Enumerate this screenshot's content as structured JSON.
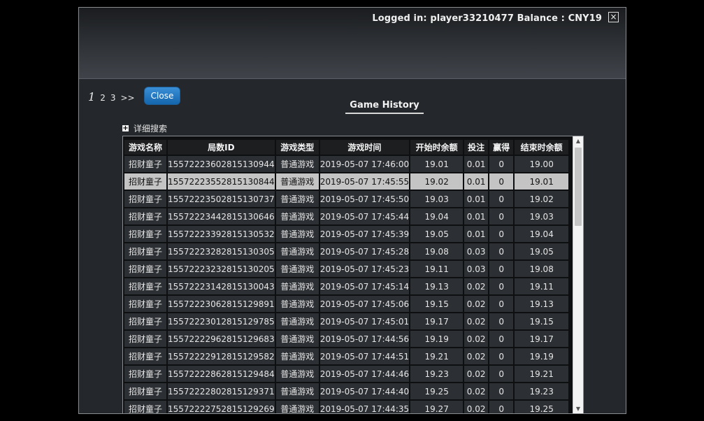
{
  "header": {
    "login_label": "Logged in: ",
    "username": "player33210477",
    "balance_label": "Balance : ",
    "balance": "CNY19",
    "close_icon": "×"
  },
  "pager": {
    "pages": [
      "1",
      "2",
      "3"
    ],
    "next": ">>",
    "current": "1"
  },
  "close_button_label": "Close",
  "title": "Game History",
  "search": {
    "icon": "+",
    "label": "详细搜索"
  },
  "table": {
    "columns": [
      "游戏名称",
      "局数ID",
      "游戏类型",
      "游戏时间",
      "开始时余额",
      "投注",
      "赢得",
      "结束时余额"
    ],
    "rows": [
      [
        "招财童子",
        "15572223602815130944",
        "普通游戏",
        "2019-05-07 17:46:00",
        "19.01",
        "0.01",
        "0",
        "19.00"
      ],
      [
        "招财童子",
        "15572223552815130844",
        "普通游戏",
        "2019-05-07 17:45:55",
        "19.02",
        "0.01",
        "0",
        "19.01"
      ],
      [
        "招财童子",
        "15572223502815130737",
        "普通游戏",
        "2019-05-07 17:45:50",
        "19.03",
        "0.01",
        "0",
        "19.02"
      ],
      [
        "招财童子",
        "15572223442815130646",
        "普通游戏",
        "2019-05-07 17:45:44",
        "19.04",
        "0.01",
        "0",
        "19.03"
      ],
      [
        "招财童子",
        "15572223392815130532",
        "普通游戏",
        "2019-05-07 17:45:39",
        "19.05",
        "0.01",
        "0",
        "19.04"
      ],
      [
        "招财童子",
        "15572223282815130305",
        "普通游戏",
        "2019-05-07 17:45:28",
        "19.08",
        "0.03",
        "0",
        "19.05"
      ],
      [
        "招财童子",
        "15572223232815130205",
        "普通游戏",
        "2019-05-07 17:45:23",
        "19.11",
        "0.03",
        "0",
        "19.08"
      ],
      [
        "招财童子",
        "15572223142815130043",
        "普通游戏",
        "2019-05-07 17:45:14",
        "19.13",
        "0.02",
        "0",
        "19.11"
      ],
      [
        "招财童子",
        "15572223062815129891",
        "普通游戏",
        "2019-05-07 17:45:06",
        "19.15",
        "0.02",
        "0",
        "19.13"
      ],
      [
        "招财童子",
        "15572223012815129785",
        "普通游戏",
        "2019-05-07 17:45:01",
        "19.17",
        "0.02",
        "0",
        "19.15"
      ],
      [
        "招财童子",
        "15572222962815129683",
        "普通游戏",
        "2019-05-07 17:44:56",
        "19.19",
        "0.02",
        "0",
        "19.17"
      ],
      [
        "招财童子",
        "15572222912815129582",
        "普通游戏",
        "2019-05-07 17:44:51",
        "19.21",
        "0.02",
        "0",
        "19.19"
      ],
      [
        "招财童子",
        "15572222862815129484",
        "普通游戏",
        "2019-05-07 17:44:46",
        "19.23",
        "0.02",
        "0",
        "19.21"
      ],
      [
        "招财童子",
        "15572222802815129371",
        "普通游戏",
        "2019-05-07 17:44:40",
        "19.25",
        "0.02",
        "0",
        "19.23"
      ],
      [
        "招财童子",
        "15572222752815129269",
        "普通游戏",
        "2019-05-07 17:44:35",
        "19.27",
        "0.02",
        "0",
        "19.25"
      ]
    ],
    "selected_row": 1
  },
  "scrollbar": {
    "up_icon": "▲",
    "down_icon": "▼"
  }
}
